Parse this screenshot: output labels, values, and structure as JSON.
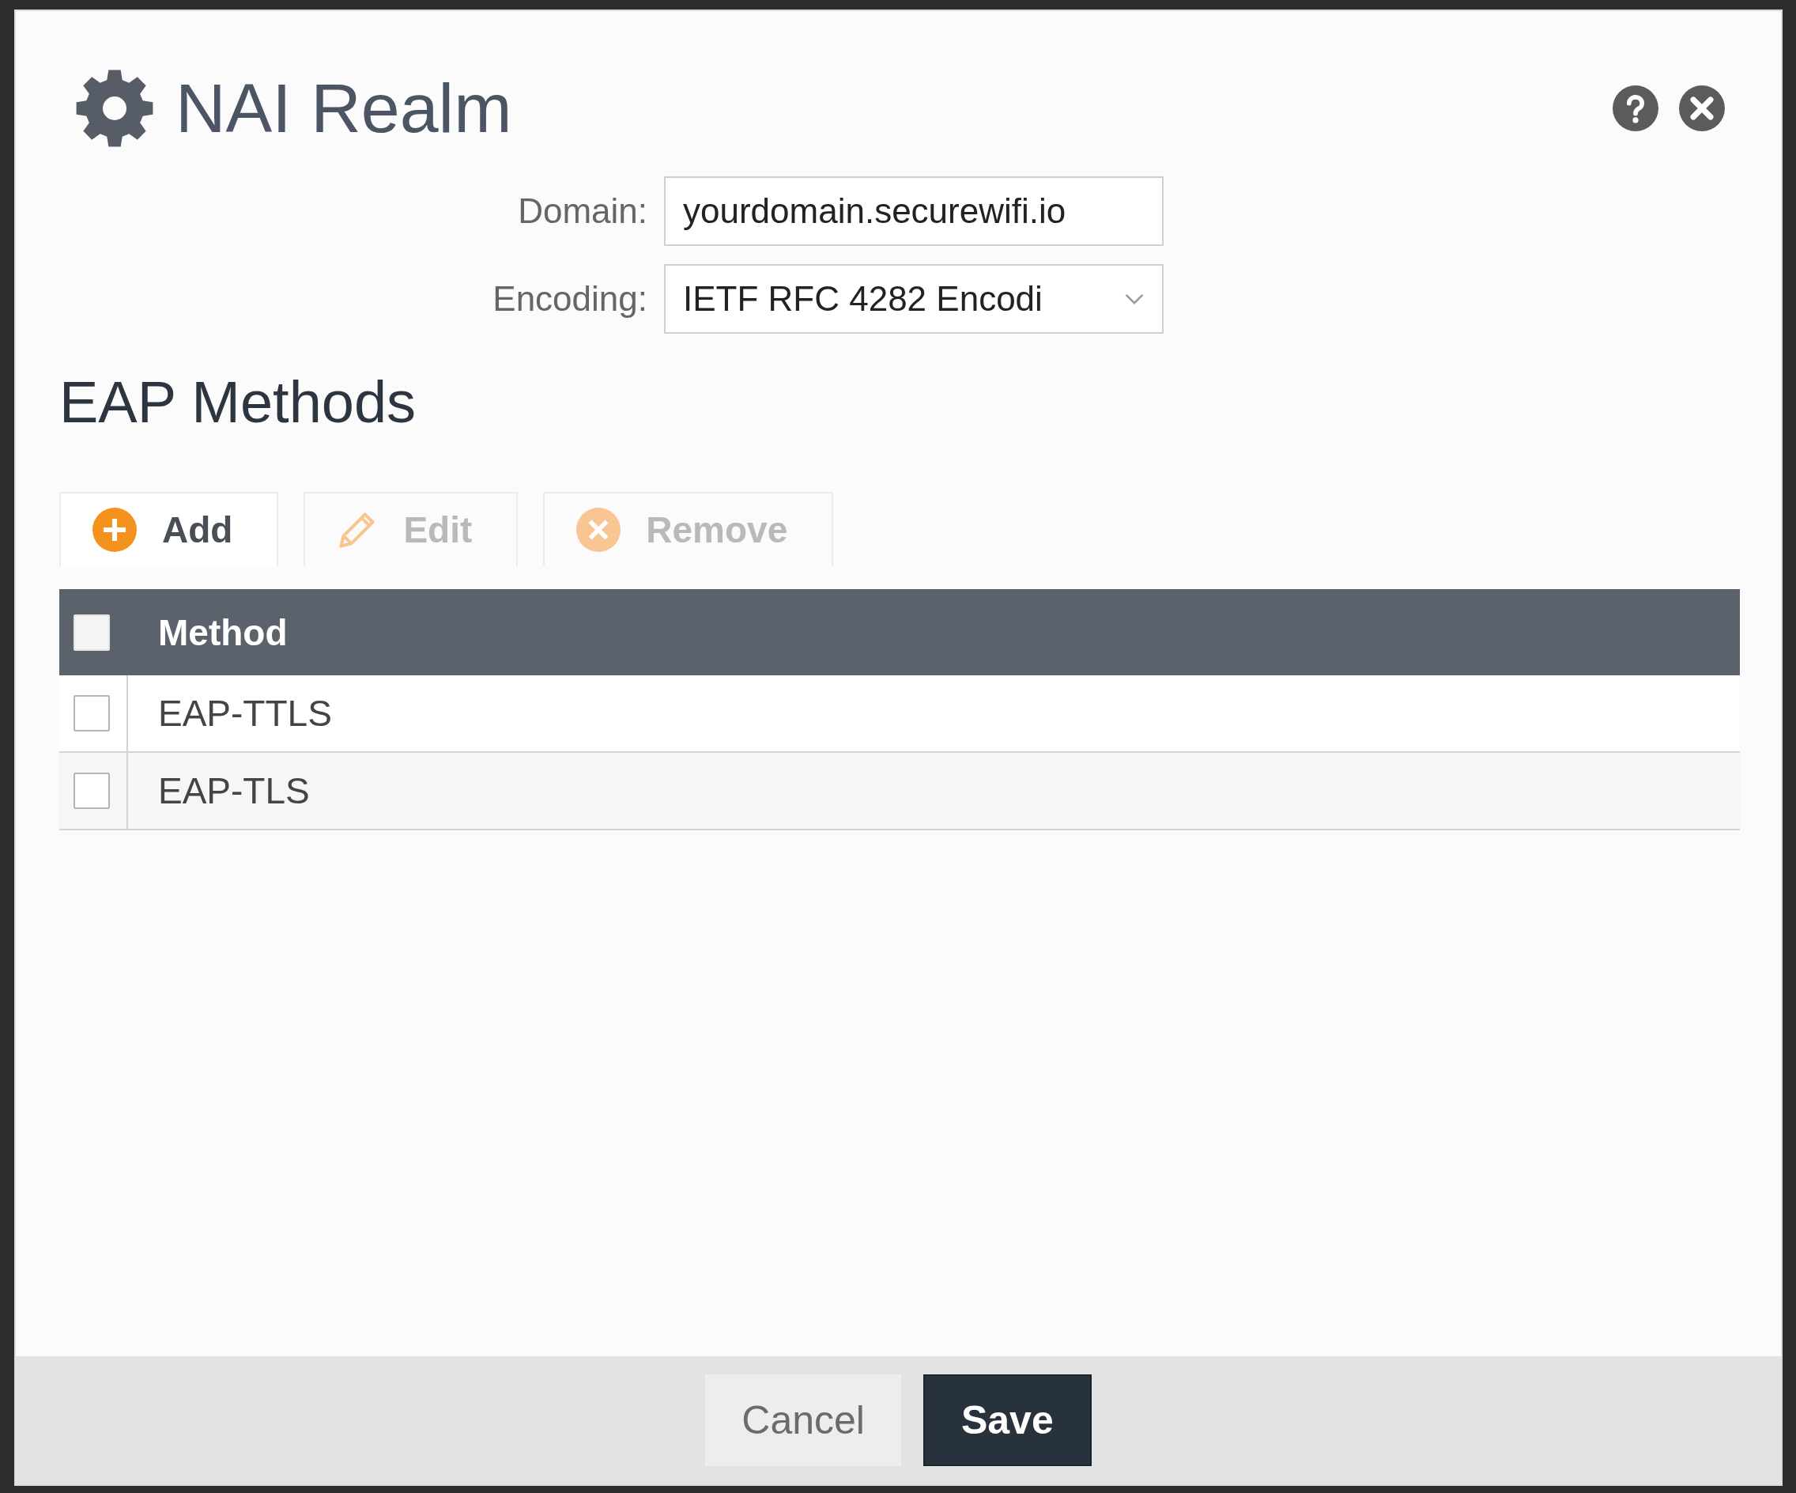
{
  "dialog": {
    "title": "NAI Realm"
  },
  "form": {
    "fields": [
      {
        "kind": "text",
        "label": "Domain:",
        "value": "yourdomain.securewifi.io"
      },
      {
        "kind": "select",
        "label": "Encoding:",
        "value": "IETF RFC 4282 Encodi"
      }
    ]
  },
  "section": {
    "title": "EAP Methods"
  },
  "toolbar": [
    {
      "kind": "add",
      "label": "Add",
      "disabled": false
    },
    {
      "kind": "edit",
      "label": "Edit",
      "disabled": true
    },
    {
      "kind": "remove",
      "label": "Remove",
      "disabled": true
    }
  ],
  "table": {
    "select_all": {
      "checked": false
    },
    "columns": [
      "Method"
    ],
    "rows": [
      {
        "method": "EAP-TTLS",
        "checked": false
      },
      {
        "method": "EAP-TLS",
        "checked": false
      }
    ]
  },
  "footer": {
    "buttons": [
      {
        "kind": "secondary",
        "label": "Cancel"
      },
      {
        "kind": "primary",
        "label": "Save"
      }
    ]
  }
}
